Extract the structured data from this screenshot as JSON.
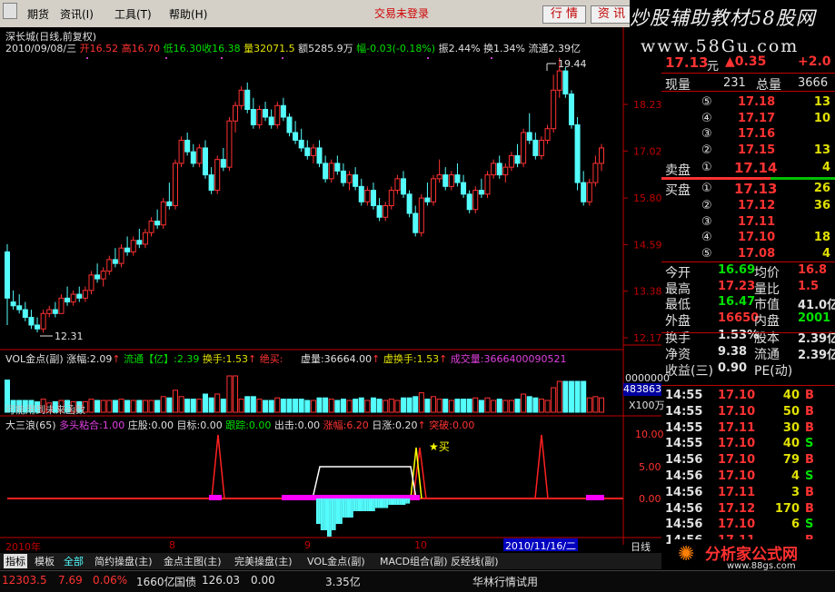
{
  "menu": {
    "items": [
      "期货",
      "资讯(I)",
      "工具(T)",
      "帮助(H)"
    ],
    "status": "交易未登录",
    "btn_quote": "行 情",
    "btn_info": "资 讯"
  },
  "logo": {
    "title": "炒股辅助教材58股网",
    "url": "www.58Gu.com"
  },
  "stock": {
    "name": "深长城(日线,前复权)"
  },
  "info_line": {
    "date": "2010/09/08/三",
    "open_lbl": "开",
    "open": "16.52",
    "high_lbl": "高",
    "high": "16.70",
    "low_lbl": "低",
    "low": "16.30",
    "close_lbl": "收",
    "close": "16.38",
    "vol_lbl": "量",
    "vol": "32071.5",
    "amt_lbl": "额",
    "amt": "5285.9万",
    "chg_lbl": "幅",
    "chg": "-0.03(-0.18%)",
    "amp": "振2.44%",
    "turn": "换1.34%",
    "float": "流通2.39亿"
  },
  "main_chart": {
    "y_ticks": [
      "18.23",
      "17.02",
      "15.80",
      "14.59",
      "13.38",
      "12.17"
    ],
    "max_label": "19.44",
    "min_label": "12.31",
    "colors": {
      "up": "#ff3232",
      "down": "#54fcfc"
    },
    "candles": [
      [
        14.4,
        14.6,
        12.5,
        13.2
      ],
      [
        13.1,
        13.4,
        12.9,
        13.0
      ],
      [
        13.0,
        13.3,
        12.8,
        12.9
      ],
      [
        12.9,
        13.1,
        12.6,
        12.7
      ],
      [
        12.7,
        12.9,
        12.4,
        12.5
      ],
      [
        12.5,
        12.7,
        12.31,
        12.4
      ],
      [
        12.4,
        12.9,
        12.3,
        12.8
      ],
      [
        12.8,
        13.0,
        12.7,
        12.9
      ],
      [
        12.9,
        13.1,
        12.7,
        12.8
      ],
      [
        12.8,
        13.3,
        12.8,
        13.2
      ],
      [
        13.2,
        13.5,
        13.0,
        13.1
      ],
      [
        13.1,
        13.4,
        13.0,
        13.3
      ],
      [
        13.3,
        13.5,
        13.1,
        13.2
      ],
      [
        13.2,
        13.5,
        13.1,
        13.4
      ],
      [
        13.4,
        13.9,
        13.3,
        13.8
      ],
      [
        13.8,
        14.1,
        13.6,
        13.7
      ],
      [
        13.7,
        14.0,
        13.5,
        13.9
      ],
      [
        13.9,
        14.3,
        13.8,
        14.2
      ],
      [
        14.2,
        14.5,
        14.0,
        14.1
      ],
      [
        14.1,
        14.6,
        14.0,
        14.5
      ],
      [
        14.5,
        14.8,
        14.3,
        14.4
      ],
      [
        14.4,
        14.8,
        14.3,
        14.7
      ],
      [
        14.7,
        15.0,
        14.5,
        14.6
      ],
      [
        14.6,
        15.0,
        14.5,
        14.9
      ],
      [
        14.9,
        15.3,
        14.8,
        15.2
      ],
      [
        15.2,
        15.5,
        15.0,
        15.1
      ],
      [
        15.1,
        15.8,
        15.0,
        15.7
      ],
      [
        15.7,
        16.2,
        15.5,
        15.6
      ],
      [
        15.6,
        16.8,
        15.5,
        16.7
      ],
      [
        16.7,
        17.4,
        16.6,
        17.3
      ],
      [
        17.3,
        17.5,
        16.9,
        17.0
      ],
      [
        17.0,
        17.2,
        16.6,
        16.7
      ],
      [
        16.7,
        17.2,
        16.6,
        17.1
      ],
      [
        17.1,
        17.3,
        16.3,
        16.4
      ],
      [
        16.4,
        16.6,
        15.9,
        16.0
      ],
      [
        16.0,
        16.9,
        15.9,
        16.8
      ],
      [
        16.8,
        17.1,
        16.5,
        16.6
      ],
      [
        16.6,
        17.9,
        16.5,
        17.8
      ],
      [
        17.8,
        18.3,
        17.5,
        18.2
      ],
      [
        18.2,
        18.7,
        18.1,
        18.6
      ],
      [
        18.6,
        18.8,
        18.0,
        18.1
      ],
      [
        18.1,
        18.4,
        17.6,
        17.7
      ],
      [
        17.7,
        18.2,
        17.6,
        18.1
      ],
      [
        18.1,
        18.3,
        17.8,
        17.9
      ],
      [
        17.9,
        18.1,
        17.6,
        17.7
      ],
      [
        17.7,
        18.3,
        17.6,
        18.2
      ],
      [
        18.2,
        18.4,
        17.8,
        17.9
      ],
      [
        17.9,
        18.0,
        17.4,
        17.5
      ],
      [
        17.5,
        17.8,
        17.2,
        17.3
      ],
      [
        17.3,
        17.6,
        17.0,
        17.1
      ],
      [
        17.1,
        17.3,
        16.8,
        16.9
      ],
      [
        16.9,
        17.2,
        16.7,
        17.1
      ],
      [
        17.1,
        17.3,
        16.6,
        16.7
      ],
      [
        16.7,
        16.9,
        16.2,
        16.3
      ],
      [
        16.3,
        16.8,
        16.2,
        16.7
      ],
      [
        16.7,
        16.9,
        16.4,
        16.5
      ],
      [
        16.5,
        16.7,
        16.1,
        16.2
      ],
      [
        16.2,
        16.5,
        16.0,
        16.4
      ],
      [
        16.4,
        16.6,
        16.0,
        16.1
      ],
      [
        16.1,
        16.3,
        15.6,
        15.7
      ],
      [
        15.7,
        16.1,
        15.6,
        16.0
      ],
      [
        16.0,
        16.2,
        15.5,
        15.6
      ],
      [
        15.6,
        15.8,
        15.2,
        15.3
      ],
      [
        15.3,
        15.7,
        15.2,
        15.6
      ],
      [
        15.6,
        16.1,
        15.5,
        16.0
      ],
      [
        16.0,
        16.4,
        15.9,
        16.3
      ],
      [
        16.3,
        16.5,
        15.8,
        15.9
      ],
      [
        15.9,
        16.0,
        15.3,
        15.4
      ],
      [
        15.4,
        15.6,
        14.8,
        14.9
      ],
      [
        14.9,
        15.9,
        14.8,
        15.8
      ],
      [
        15.8,
        16.2,
        15.6,
        15.7
      ],
      [
        15.7,
        16.4,
        15.6,
        16.3
      ],
      [
        16.3,
        16.8,
        16.2,
        16.4
      ],
      [
        16.4,
        16.6,
        16.0,
        16.1
      ],
      [
        16.1,
        16.5,
        16.0,
        16.4
      ],
      [
        16.4,
        16.7,
        16.1,
        16.2
      ],
      [
        16.2,
        16.4,
        15.8,
        15.9
      ],
      [
        15.9,
        16.0,
        15.4,
        15.5
      ],
      [
        15.5,
        16.1,
        15.4,
        16.0
      ],
      [
        16.0,
        16.3,
        15.8,
        15.9
      ],
      [
        15.9,
        16.5,
        15.8,
        16.4
      ],
      [
        16.4,
        16.8,
        16.3,
        16.7
      ],
      [
        16.7,
        16.9,
        16.3,
        16.4
      ],
      [
        16.4,
        16.7,
        16.2,
        16.6
      ],
      [
        16.6,
        17.0,
        16.5,
        16.9
      ],
      [
        16.9,
        17.2,
        16.6,
        16.7
      ],
      [
        16.7,
        17.6,
        16.6,
        17.5
      ],
      [
        17.5,
        18.0,
        17.2,
        17.3
      ],
      [
        17.3,
        17.5,
        16.8,
        16.9
      ],
      [
        16.9,
        17.4,
        16.8,
        17.3
      ],
      [
        17.3,
        17.7,
        17.2,
        17.6
      ],
      [
        17.6,
        19.0,
        17.5,
        18.6
      ],
      [
        18.6,
        19.44,
        18.4,
        19.1
      ],
      [
        19.1,
        19.2,
        18.4,
        18.5
      ],
      [
        18.5,
        18.6,
        17.6,
        17.7
      ],
      [
        17.7,
        17.9,
        16.0,
        16.2
      ],
      [
        16.2,
        16.5,
        15.6,
        15.7
      ],
      [
        15.7,
        16.3,
        15.6,
        16.2
      ],
      [
        16.2,
        16.9,
        16.1,
        16.7
      ],
      [
        16.7,
        17.2,
        16.5,
        17.1
      ]
    ]
  },
  "vol_panel": {
    "header": {
      "name": "VOL金点(副)",
      "zf": "涨幅:2.09",
      "lt": "流通【亿】:2.39",
      "hs": "换手:1.53",
      "jm": "绝买:",
      "xl": "虚量:36664.00",
      "xhs": "虚换手:1.53",
      "cjl": "成交量:3666400090521"
    },
    "note": "可能用到未来函数",
    "box_val": "483863",
    "box_unit": "X100万",
    "zero_label": "0000000"
  },
  "dsl_panel": {
    "header": {
      "name": "大三浪(65)",
      "dtzh": "多头粘合:1.00",
      "zp": "庄股:0.00",
      "mb": "目标:0.00",
      "gz": "跟踪:0.00",
      "cj": "出击:0.00",
      "zf": "涨幅:6.20",
      "rz": "日涨:0.20",
      "tp": "突破:0.00"
    },
    "y_ticks": [
      "10.00",
      "5.00",
      "0.00"
    ],
    "buy_label": "买"
  },
  "x_axis": {
    "labels": [
      "2010年",
      "8",
      "9",
      "10"
    ],
    "cursor_date": "2010/11/16/二",
    "period": "日线"
  },
  "quote": {
    "price": "17.13",
    "unit": "元",
    "change": "▲0.35",
    "change_pct": "+2.0",
    "xianliang_lbl": "现量",
    "xianliang": "231",
    "zongliang_lbl": "总量",
    "zongliang": "3666",
    "sell_lbl": "卖盘",
    "buy_lbl": "买盘",
    "sells": [
      {
        "idx": "⑤",
        "price": "17.18",
        "vol": "13"
      },
      {
        "idx": "④",
        "price": "17.17",
        "vol": "10"
      },
      {
        "idx": "③",
        "price": "17.16",
        "vol": ""
      },
      {
        "idx": "②",
        "price": "17.15",
        "vol": "13"
      },
      {
        "idx": "①",
        "price": "17.14",
        "vol": "4"
      }
    ],
    "buys": [
      {
        "idx": "①",
        "price": "17.13",
        "vol": "26"
      },
      {
        "idx": "②",
        "price": "17.12",
        "vol": "36"
      },
      {
        "idx": "③",
        "price": "17.11",
        "vol": ""
      },
      {
        "idx": "④",
        "price": "17.10",
        "vol": "18"
      },
      {
        "idx": "⑤",
        "price": "17.08",
        "vol": "4"
      }
    ],
    "stats": [
      [
        "今开",
        "16.69",
        "均价",
        "16.8"
      ],
      [
        "最高",
        "17.23",
        "量比",
        "1.5"
      ],
      [
        "最低",
        "16.47",
        "市值",
        "41.0亿"
      ],
      [
        "外盘",
        "16650",
        "内盘",
        "2001"
      ],
      [
        "换手",
        "1.53%",
        "股本",
        "2.39亿"
      ],
      [
        "净资",
        "9.38",
        "流通",
        "2.39亿"
      ],
      [
        "收益(三)",
        "0.90",
        "PE(动)",
        ""
      ]
    ],
    "ticks": [
      [
        "14:55",
        "17.10",
        "40",
        "B"
      ],
      [
        "14:55",
        "17.10",
        "50",
        "B"
      ],
      [
        "14:55",
        "17.11",
        "30",
        "B"
      ],
      [
        "14:55",
        "17.10",
        "40",
        "S"
      ],
      [
        "14:56",
        "17.10",
        "79",
        "B"
      ],
      [
        "14:56",
        "17.10",
        "4",
        "S"
      ],
      [
        "14:56",
        "17.11",
        "3",
        "B"
      ],
      [
        "14:56",
        "17.12",
        "170",
        "B"
      ],
      [
        "14:56",
        "17.10",
        "6",
        "S"
      ],
      [
        "14:56",
        "17.11",
        "",
        "B"
      ]
    ]
  },
  "bottom_tabs": [
    "指标",
    "模板",
    "全部",
    "简约操盘(主)",
    "金点主图(主)",
    "完美操盘(主)",
    "VOL金点(副)",
    "MACD组合(副)",
    "反经线(副)"
  ],
  "ticker": {
    "index": "12303.5",
    "chg": "7.69",
    "pct": "0.06%",
    "amt": "1660亿",
    "bond_lbl": "国债",
    "bond": "126.03",
    "bond_chg": "0.00",
    "bond_amt": "3.35亿",
    "msg": "华林行情试用"
  },
  "watermark": {
    "title": "分析家公式网",
    "url": "www.88gs.com"
  }
}
